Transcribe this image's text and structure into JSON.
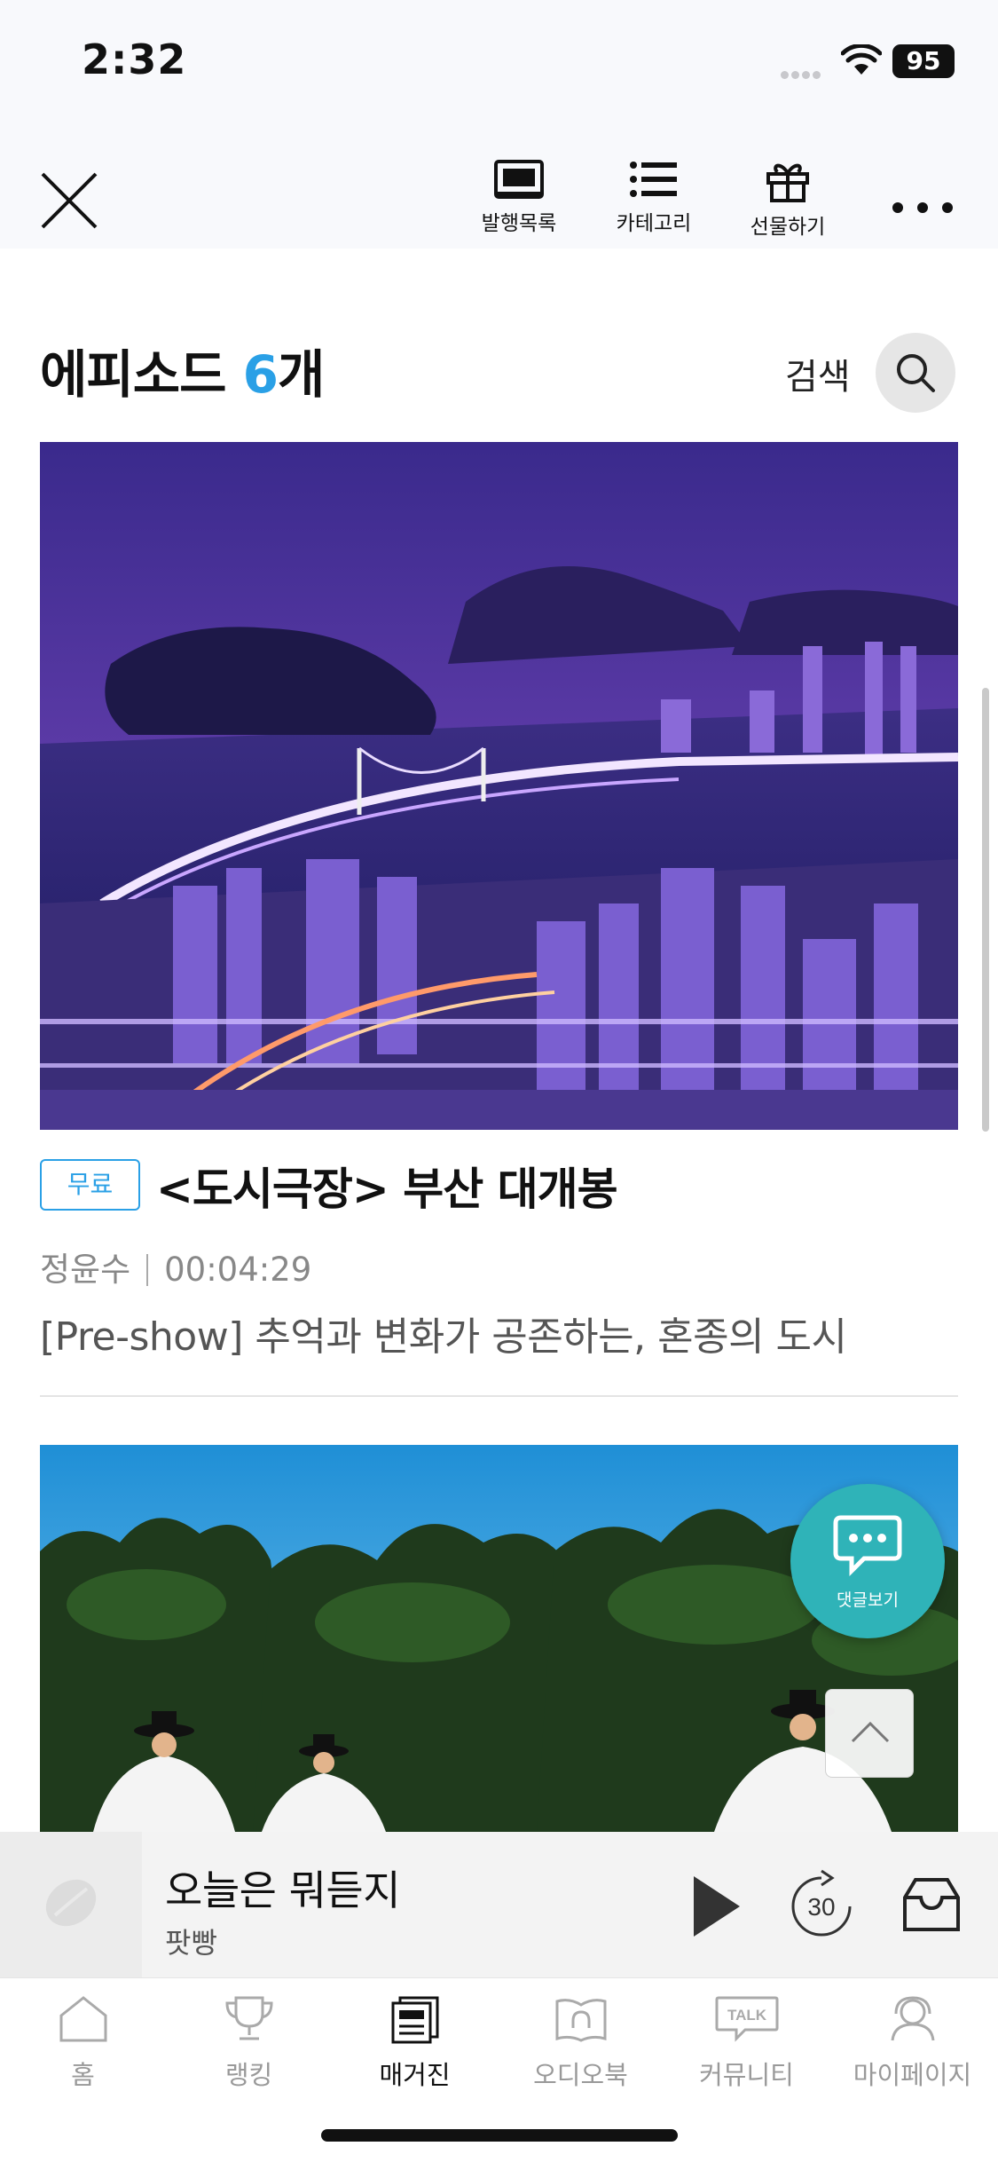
{
  "status_bar": {
    "time": "2:32",
    "battery": "95"
  },
  "top_nav": {
    "actions": [
      {
        "label": "발행목록",
        "icon": "issue-list-icon"
      },
      {
        "label": "카테고리",
        "icon": "category-list-icon"
      },
      {
        "label": "선물하기",
        "icon": "gift-icon"
      }
    ]
  },
  "episodes_header": {
    "title_prefix": "에피소드 ",
    "count": "6",
    "title_suffix": "개",
    "search_label": "검색"
  },
  "episodes": [
    {
      "badge": "무료",
      "title": "<도시극장> 부산 대개봉",
      "author": "정윤수",
      "duration": "00:04:29",
      "description": "[Pre-show] 추억과 변화가 공존하는, 혼종의 도시",
      "thumbnail": "busan-night-bridge-photo"
    },
    {
      "thumbnail": "traditional-dance-in-pine-forest-photo"
    }
  ],
  "floating": {
    "comment_label": "댓글보기",
    "accent": "#2fb3b8"
  },
  "mini_player": {
    "title": "오늘은 뭐듣지",
    "subtitle": "팟빵",
    "skip_seconds": "30"
  },
  "tabs": [
    {
      "label": "홈",
      "icon": "home-icon",
      "active": false
    },
    {
      "label": "랭킹",
      "icon": "trophy-icon",
      "active": false
    },
    {
      "label": "매거진",
      "icon": "magazine-icon",
      "active": true
    },
    {
      "label": "오디오북",
      "icon": "audiobook-icon",
      "active": false
    },
    {
      "label": "커뮤니티",
      "icon": "talk-icon",
      "active": false
    },
    {
      "label": "마이페이지",
      "icon": "profile-icon",
      "active": false
    }
  ],
  "colors": {
    "accent_blue": "#2aa0e6",
    "comment_teal": "#2fb3b8"
  }
}
